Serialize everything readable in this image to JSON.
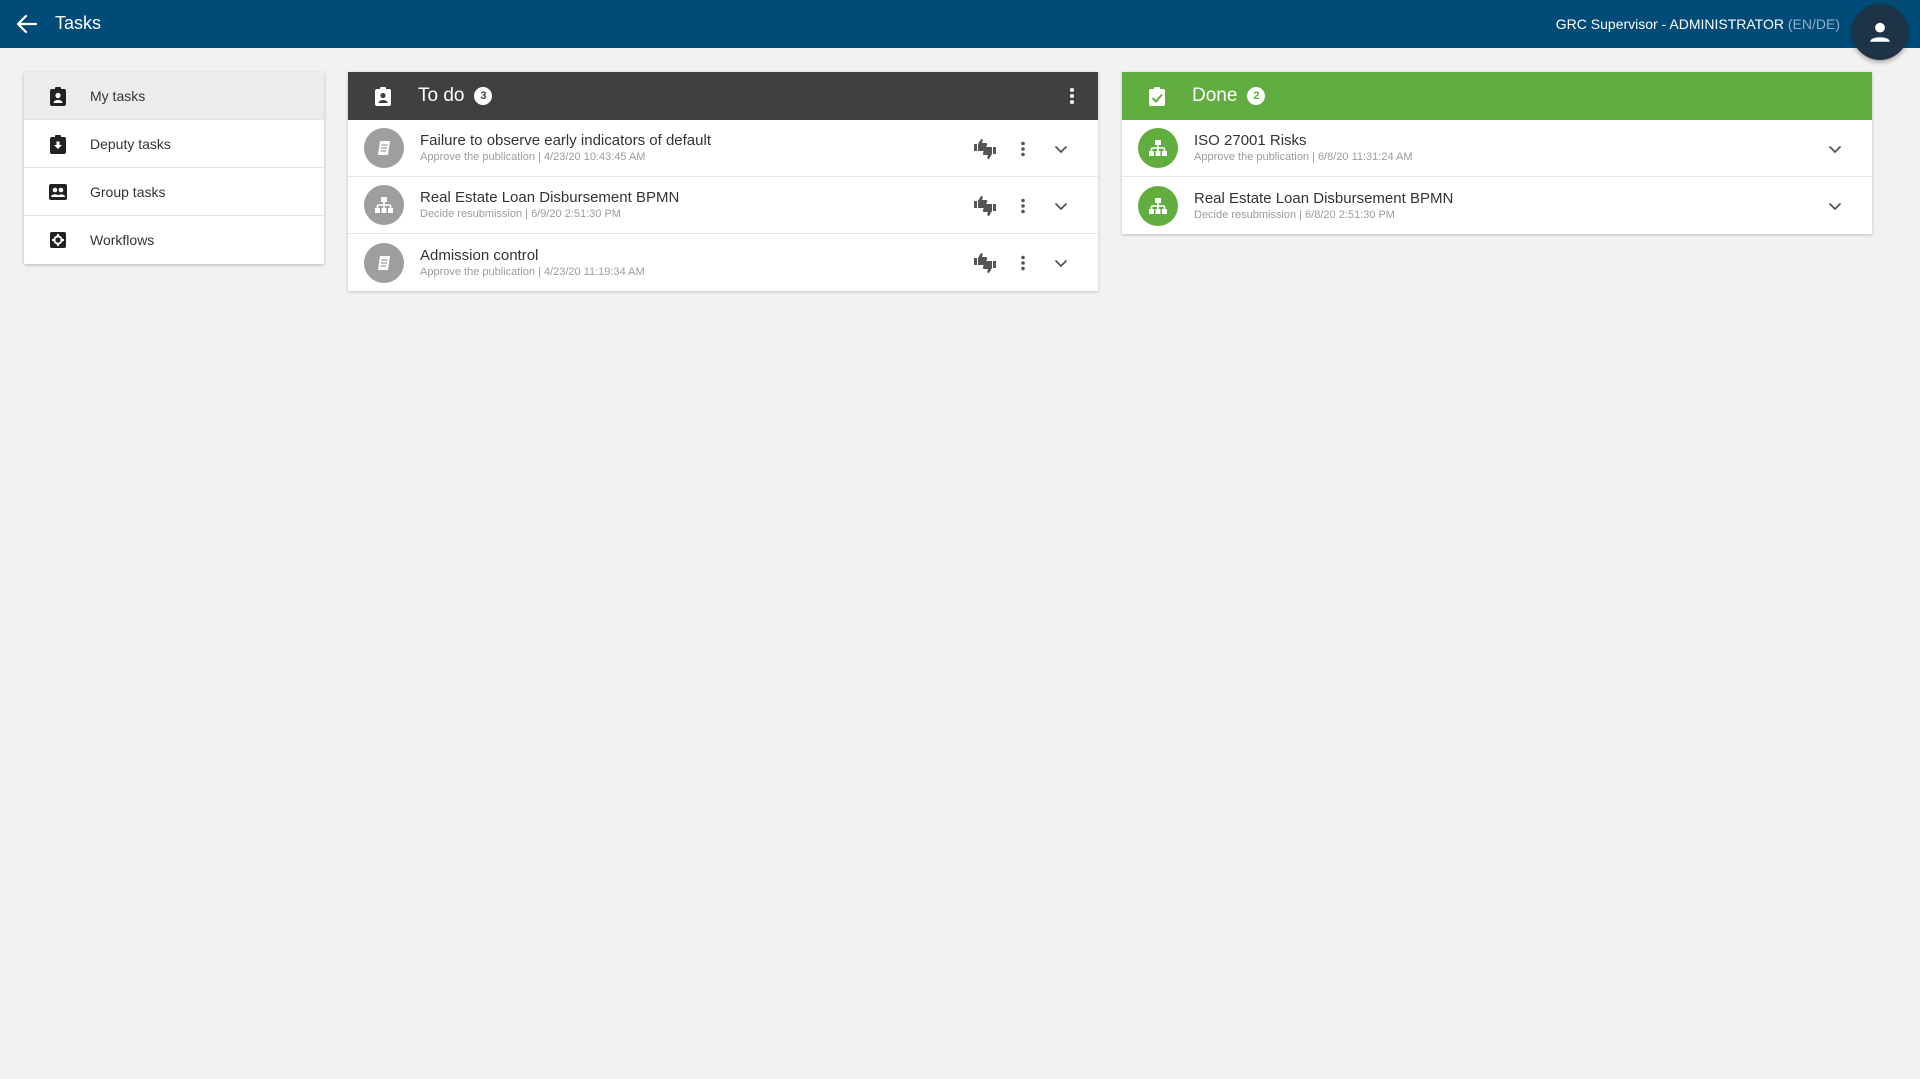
{
  "header": {
    "title": "Tasks",
    "user": "GRC Supervisor - ADMINISTRATOR",
    "lang": "(EN/DE)"
  },
  "sidebar": {
    "items": [
      {
        "label": "My tasks",
        "icon": "assignment-ind-icon",
        "active": true
      },
      {
        "label": "Deputy tasks",
        "icon": "assignment-return-icon",
        "active": false
      },
      {
        "label": "Group tasks",
        "icon": "group-contact-icon",
        "active": false
      },
      {
        "label": "Workflows",
        "icon": "workflow-settings-icon",
        "active": false
      }
    ]
  },
  "todo": {
    "title": "To do",
    "count": "3",
    "color": "#404040",
    "tasks": [
      {
        "title": "Failure to observe early indicators of default",
        "subtitle": "Approve the publication | 4/23/20 10:43:45 AM",
        "icon": "document-icon"
      },
      {
        "title": "Real Estate Loan Disbursement BPMN",
        "subtitle": "Decide resubmission | 6/9/20 2:51:30 PM",
        "icon": "org-chart-icon"
      },
      {
        "title": "Admission control",
        "subtitle": "Approve the publication | 4/23/20 11:19:34 AM",
        "icon": "document-icon"
      }
    ]
  },
  "done": {
    "title": "Done",
    "count": "2",
    "color": "#62ad3f",
    "tasks": [
      {
        "title": "ISO 27001 Risks",
        "subtitle": "Approve the publication | 6/8/20 11:31:24 AM",
        "icon": "org-chart-icon"
      },
      {
        "title": "Real Estate Loan Disbursement BPMN",
        "subtitle": "Decide resubmission | 6/8/20 2:51:30 PM",
        "icon": "org-chart-icon"
      }
    ]
  }
}
